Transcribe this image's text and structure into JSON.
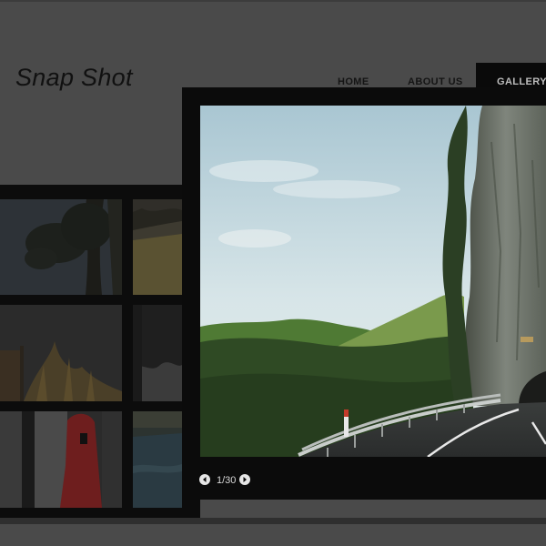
{
  "site": {
    "logo": "Snap Shot"
  },
  "nav": {
    "home": "HOME",
    "about": "ABOUT US",
    "gallery": "GALLERY"
  },
  "viewer": {
    "counter": "1/30"
  },
  "colors": {
    "background": "#4a4a4a",
    "frame": "#0b0b0b",
    "active_nav": "#0a0a0a"
  },
  "icons": {
    "prev": "arrow-left-circle",
    "next": "arrow-right-circle"
  }
}
